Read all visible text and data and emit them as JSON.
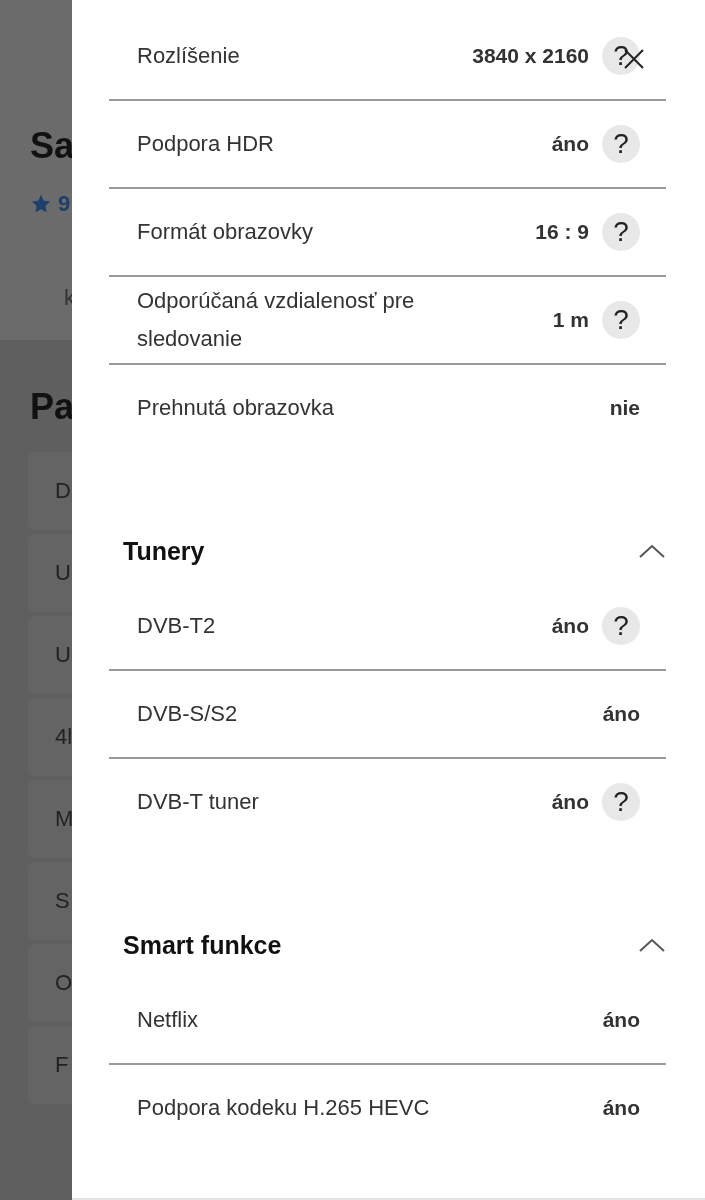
{
  "background_page": {
    "heading": "Sa",
    "rating": "9",
    "tab": "k",
    "section_heading": "Pa",
    "items": [
      "D",
      "U",
      "U",
      "4l",
      "M",
      "S",
      "O",
      "F"
    ]
  },
  "drawer": {
    "sections": [
      {
        "rows": [
          {
            "label": "Rozlíšenie",
            "value": "3840 x 2160",
            "help": "?"
          },
          {
            "label": "Podpora HDR",
            "value": "áno",
            "help": "?"
          },
          {
            "label": "Formát obrazovky",
            "value": "16 : 9",
            "help": "?"
          },
          {
            "label": "Odporúčaná vzdialenosť pre sledovanie",
            "value": "1 m",
            "help": "?"
          },
          {
            "label": "Prehnutá obrazovka",
            "value": "nie"
          }
        ]
      },
      {
        "title": "Tunery",
        "expanded": true,
        "rows": [
          {
            "label": "DVB-T2",
            "value": "áno",
            "help": "?"
          },
          {
            "label": "DVB-S/S2",
            "value": "áno"
          },
          {
            "label": "DVB-T tuner",
            "value": "áno",
            "help": "?"
          }
        ]
      },
      {
        "title": "Smart funkce",
        "expanded": true,
        "rows": [
          {
            "label": "Netflix",
            "value": "áno"
          },
          {
            "label": "Podpora kodeku H.265 HEVC",
            "value": "áno"
          }
        ]
      }
    ]
  }
}
